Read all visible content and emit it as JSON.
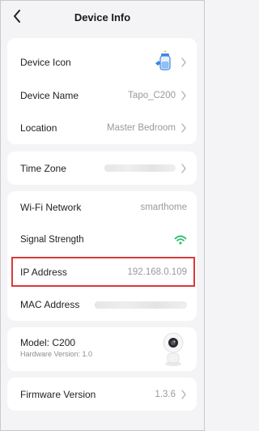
{
  "header": {
    "title": "Device Info"
  },
  "device_card": {
    "icon_label": "Device Icon",
    "name_label": "Device Name",
    "name_value": "Tapo_C200",
    "location_label": "Location",
    "location_value": "Master Bedroom"
  },
  "time_zone": {
    "label": "Time Zone"
  },
  "network": {
    "wifi_label": "Wi-Fi Network",
    "wifi_value": "smarthome",
    "signal_label": "Signal Strength",
    "ip_label": "IP Address",
    "ip_value": "192.168.0.109",
    "mac_label": "MAC Address"
  },
  "model": {
    "model_label": "Model: C200",
    "hardware_label": "Hardware Version: 1.0"
  },
  "firmware": {
    "label": "Firmware Version",
    "value": "1.3.6"
  },
  "colors": {
    "wifi_signal": "#2fbf71",
    "highlight": "#d93a3a"
  }
}
